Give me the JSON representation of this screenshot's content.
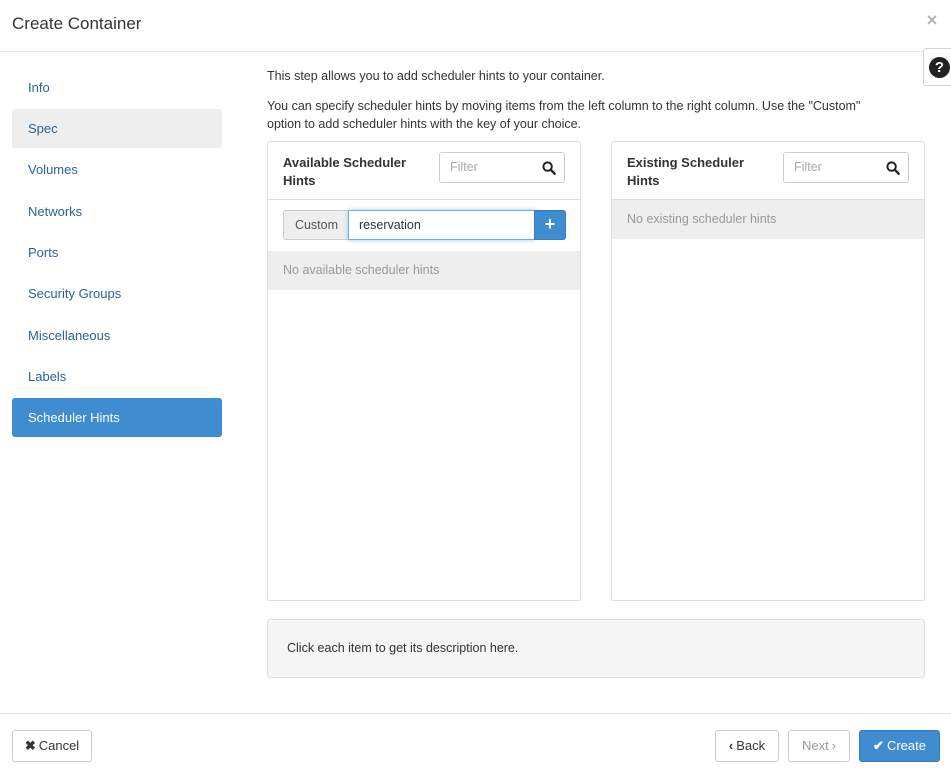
{
  "modal": {
    "title": "Create Container",
    "close_icon": "×",
    "help_icon": "?"
  },
  "nav": {
    "items": [
      {
        "label": "Info",
        "state": "link"
      },
      {
        "label": "Spec",
        "state": "visited"
      },
      {
        "label": "Volumes",
        "state": "link"
      },
      {
        "label": "Networks",
        "state": "link"
      },
      {
        "label": "Ports",
        "state": "link"
      },
      {
        "label": "Security Groups",
        "state": "link"
      },
      {
        "label": "Miscellaneous",
        "state": "link"
      },
      {
        "label": "Labels",
        "state": "link"
      },
      {
        "label": "Scheduler Hints",
        "state": "active"
      }
    ]
  },
  "intro": {
    "line1": "This step allows you to add scheduler hints to your container.",
    "line2": "You can specify scheduler hints by moving items from the left column to the right column. Use the \"Custom\" option to add scheduler hints with the key of your choice."
  },
  "available": {
    "title": "Available Scheduler Hints",
    "filter_placeholder": "Filter",
    "custom_label": "Custom",
    "custom_value": "reservation",
    "add_icon": "+",
    "empty_text": "No available scheduler hints"
  },
  "existing": {
    "title": "Existing Scheduler Hints",
    "filter_placeholder": "Filter",
    "empty_text": "No existing scheduler hints"
  },
  "description": "Click each item to get its description here.",
  "footer": {
    "cancel_icon": "✖",
    "cancel_label": "Cancel",
    "back_icon": "‹",
    "back_label": "Back",
    "next_label": "Next",
    "next_icon": "›",
    "create_icon": "✔",
    "create_label": "Create"
  },
  "colors": {
    "accent": "#3f8cd1",
    "link": "#2a6496"
  }
}
